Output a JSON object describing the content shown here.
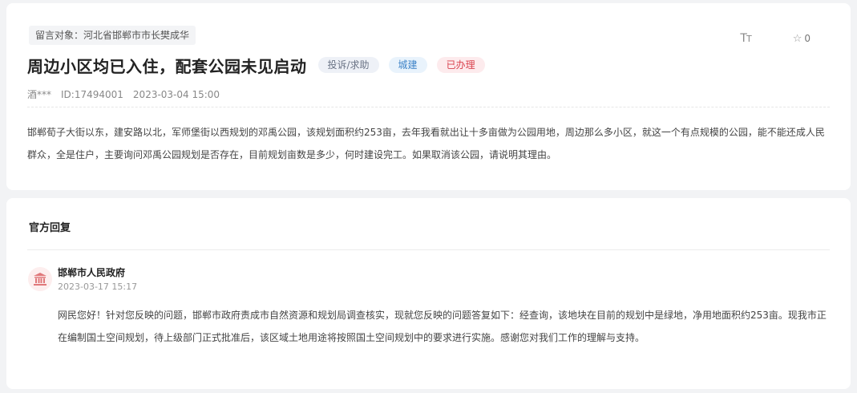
{
  "message": {
    "target_label": "留言对象：河北省邯郸市市长樊成华",
    "title": "周边小区均已入住，配套公园未见启动",
    "tags": {
      "type": "投诉/求助",
      "category": "城建",
      "status": "已办理"
    },
    "author": "酒***",
    "id_text": "ID:17494001",
    "datetime": "2023-03-04 15:00",
    "font_toggle_icon": "font-size-icon",
    "star_icon": "star-icon",
    "star_count": "0",
    "body": "邯郸荀子大街以东，建安路以北，军师堡街以西规划的邓禹公园，该规划面积约253亩，去年我看就出让十多亩做为公园用地，周边那么多小区，就这一个有点规模的公园，能不能还成人民群众，全是住户，主要询问邓禹公园规划是否存在，目前规划亩数是多少，何时建设完工。如果取消该公园，请说明其理由。"
  },
  "reply": {
    "section_title": "官方回复",
    "avatar_icon": "government-building-icon",
    "org": "邯郸市人民政府",
    "date": "2023-03-17 15:17",
    "body": "网民您好！针对您反映的问题，邯郸市政府责成市自然资源和规划局调查核实，现就您反映的问题答复如下：经查询，该地块在目前的规划中是绿地，净用地面积约253亩。现我市正在编制国土空间规划，待上级部门正式批准后，该区域土地用途将按照国土空间规划中的要求进行实施。感谢您对我们工作的理解与支持。"
  },
  "colors": {
    "tag_type_text": "#6a7385",
    "tag_category_text": "#3f84c8",
    "tag_status_text": "#d9434f",
    "avatar_icon": "#e0787a"
  }
}
